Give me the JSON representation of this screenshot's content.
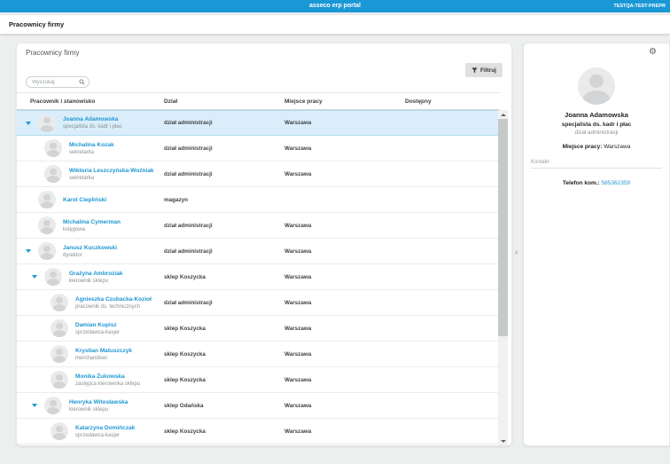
{
  "topbar": {
    "title": "asseco erp portal",
    "environment": "TESTQA-TEST-PREPR"
  },
  "breadcrumb": {
    "title": "Pracownicy firmy"
  },
  "employees_card": {
    "title": "Pracownicy firmy",
    "filter_button_label": "Filtruj",
    "search_placeholder": "Wyszukaj",
    "columns": [
      "Pracownik i stanowisko",
      "Dział",
      "Miejsce pracy",
      "Dostępny"
    ],
    "rows": [
      {
        "name": "Joanna Adamowska",
        "position": "specjalista ds. kadr i płac",
        "department": "dział administracji",
        "workplace": "Warszawa",
        "level": 0,
        "has_children": true,
        "selected": true
      },
      {
        "name": "Michalina Kozak",
        "position": "sekretarka",
        "department": "dział administracji",
        "workplace": "Warszawa",
        "level": 1,
        "has_children": false,
        "selected": false
      },
      {
        "name": "Wiktoria Leszczyńska-Woźniak",
        "position": "sekretarka",
        "department": "dział administracji",
        "workplace": "Warszawa",
        "level": 1,
        "has_children": false,
        "selected": false
      },
      {
        "name": "Karol Ciepliński",
        "position": "",
        "department": "magazyn",
        "workplace": "",
        "level": 0,
        "has_children": false,
        "selected": false
      },
      {
        "name": "Michalina Cymerman",
        "position": "księgowa",
        "department": "dział administracji",
        "workplace": "Warszawa",
        "level": 0,
        "has_children": false,
        "selected": false
      },
      {
        "name": "Janusz Kuczkowski",
        "position": "dyrektor",
        "department": "dział administracji",
        "workplace": "Warszawa",
        "level": 0,
        "has_children": true,
        "selected": false
      },
      {
        "name": "Grażyna Ambroziak",
        "position": "kierownik sklepu",
        "department": "sklep Koszycka",
        "workplace": "Warszawa",
        "level": 1,
        "has_children": true,
        "selected": false
      },
      {
        "name": "Agnieszka Czubacka-Kozioł",
        "position": "pracownik ds. technicznych",
        "department": "dział administracji",
        "workplace": "Warszawa",
        "level": 2,
        "has_children": false,
        "selected": false
      },
      {
        "name": "Damian Kupisz",
        "position": "sprzedawca-kasjer",
        "department": "sklep Koszycka",
        "workplace": "Warszawa",
        "level": 2,
        "has_children": false,
        "selected": false
      },
      {
        "name": "Krystian Matuszczyk",
        "position": "merchandiser",
        "department": "sklep Koszycka",
        "workplace": "Warszawa",
        "level": 2,
        "has_children": false,
        "selected": false
      },
      {
        "name": "Monika Żukowska",
        "position": "zastępca kierownika sklepu",
        "department": "sklep Koszycka",
        "workplace": "Warszawa",
        "level": 2,
        "has_children": false,
        "selected": false
      },
      {
        "name": "Henryka Witosławska",
        "position": "kierownik sklepu",
        "department": "sklep Gdańska",
        "workplace": "Warszawa",
        "level": 1,
        "has_children": true,
        "selected": false
      },
      {
        "name": "Katarzyna Domińczak",
        "position": "sprzedawca-kasjer",
        "department": "sklep Koszycka",
        "workplace": "Warszawa",
        "level": 2,
        "has_children": false,
        "selected": false
      }
    ]
  },
  "detail_panel": {
    "name": "Joanna Adamowska",
    "position": "specjalista ds. kadr i płac",
    "department": "dział administracji",
    "workplace_label": "Miejsce pracy:",
    "workplace_value": "Warszawa",
    "contact_section_label": "Kontakt",
    "phone_label": "Telefon kom.:",
    "phone_value": "585362359"
  },
  "icons": {
    "settings_glyph": "⚙",
    "panel_collapse_glyph": "›"
  },
  "colors": {
    "topbar_blue": "#1a97d5",
    "link_blue": "#1e96d2",
    "selected_row_bg": "#d9eefa",
    "filter_button_bg": "#e0e0e0"
  }
}
